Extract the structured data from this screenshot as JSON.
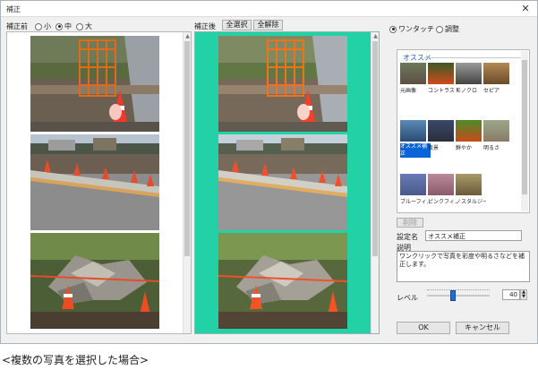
{
  "window": {
    "title": "補正",
    "close_glyph": "✕"
  },
  "left_header": {
    "label": "補正前",
    "size_options": [
      {
        "label": "小",
        "selected": false
      },
      {
        "label": "中",
        "selected": true
      },
      {
        "label": "大",
        "selected": false
      }
    ]
  },
  "right_header": {
    "label": "補正後",
    "select_all_label": "全選択",
    "deselect_all_label": "全解除"
  },
  "mode_options": [
    {
      "label": "ワンタッチ",
      "selected": true
    },
    {
      "label": "調整",
      "selected": false
    }
  ],
  "filters": {
    "heading": "オススメ",
    "items": [
      {
        "label": "元画像",
        "icon": "original-thumbnail",
        "selected": false
      },
      {
        "label": "コントラスト",
        "icon": "contrast-thumbnail",
        "selected": false
      },
      {
        "label": "モノクロ",
        "icon": "monochrome-thumbnail",
        "selected": false
      },
      {
        "label": "セピア",
        "icon": "sepia-thumbnail",
        "selected": false
      },
      {
        "label": "オススメ補正",
        "icon": "recommended-thumbnail",
        "selected": true
      },
      {
        "label": "夜景",
        "icon": "night-thumbnail",
        "selected": false
      },
      {
        "label": "鮮やか",
        "icon": "vivid-thumbnail",
        "selected": false
      },
      {
        "label": "明るさ",
        "icon": "brightness-thumbnail",
        "selected": false
      },
      {
        "label": "ブルーフィ...",
        "icon": "blue-filter-thumbnail",
        "selected": false
      },
      {
        "label": "ピンクフィ...",
        "icon": "pink-filter-thumbnail",
        "selected": false
      },
      {
        "label": "ノスタルジー",
        "icon": "nostalgia-thumbnail",
        "selected": false
      }
    ]
  },
  "delete_button_label": "削除",
  "settings": {
    "name_label": "設定名",
    "name_value": "オススメ補正",
    "description_label": "説明",
    "description_value": "ワンクリックで写真を彩度や明るさなどを補正します。"
  },
  "level": {
    "label": "レベル",
    "value": "40",
    "fraction": 0.4
  },
  "ok_label": "OK",
  "cancel_label": "キャンセル",
  "caption": "<複数の写真を選択した場合>",
  "colors": {
    "selection_green": "#22d1a6",
    "accent_blue": "#1f6fd1"
  }
}
